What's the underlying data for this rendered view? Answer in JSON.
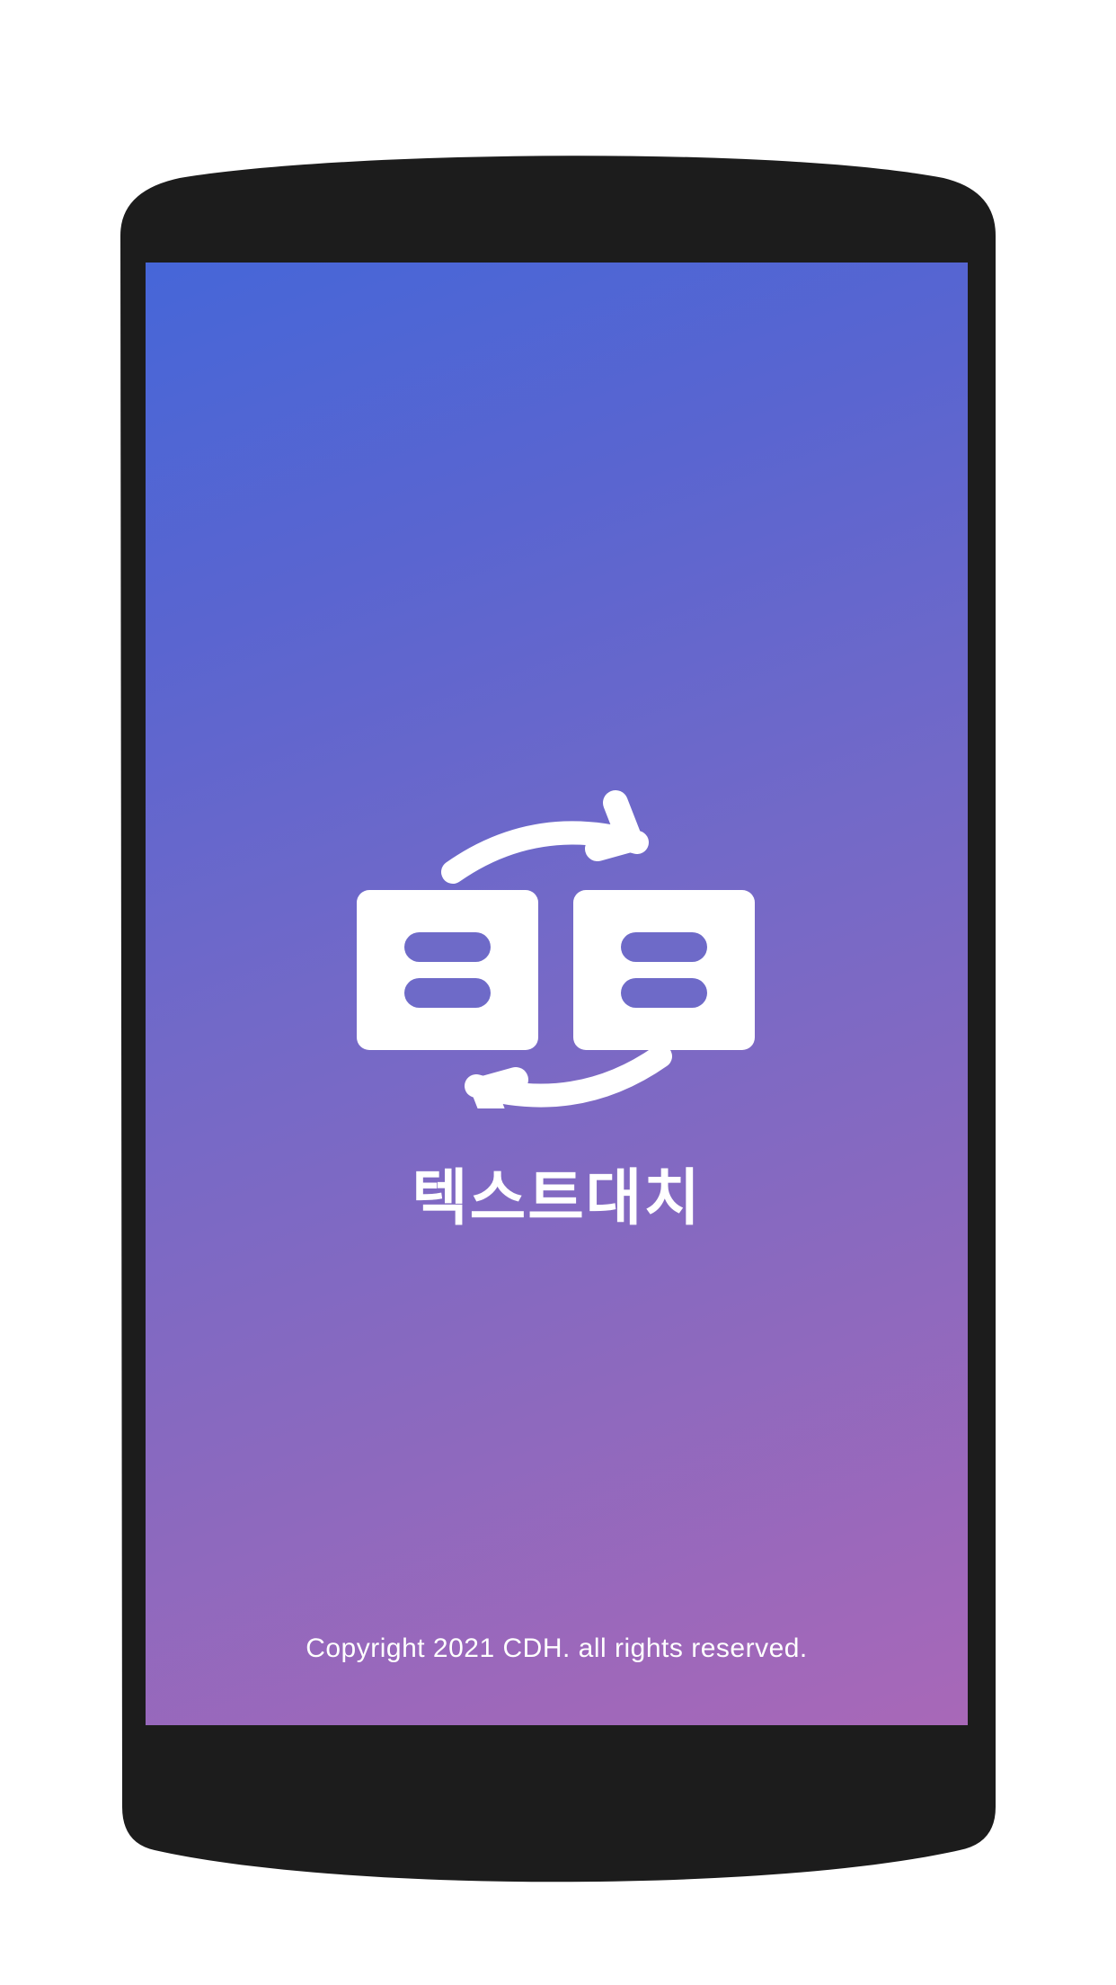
{
  "splash": {
    "app_name": "텍스트대치",
    "copyright": "Copyright 2021 CDH. all rights reserved.",
    "logo_icon": "text-swap-icon"
  },
  "colors": {
    "frame": "#1c1c1c",
    "gradient_start": "#4666d8",
    "gradient_end": "#a868b8",
    "text": "#ffffff"
  }
}
